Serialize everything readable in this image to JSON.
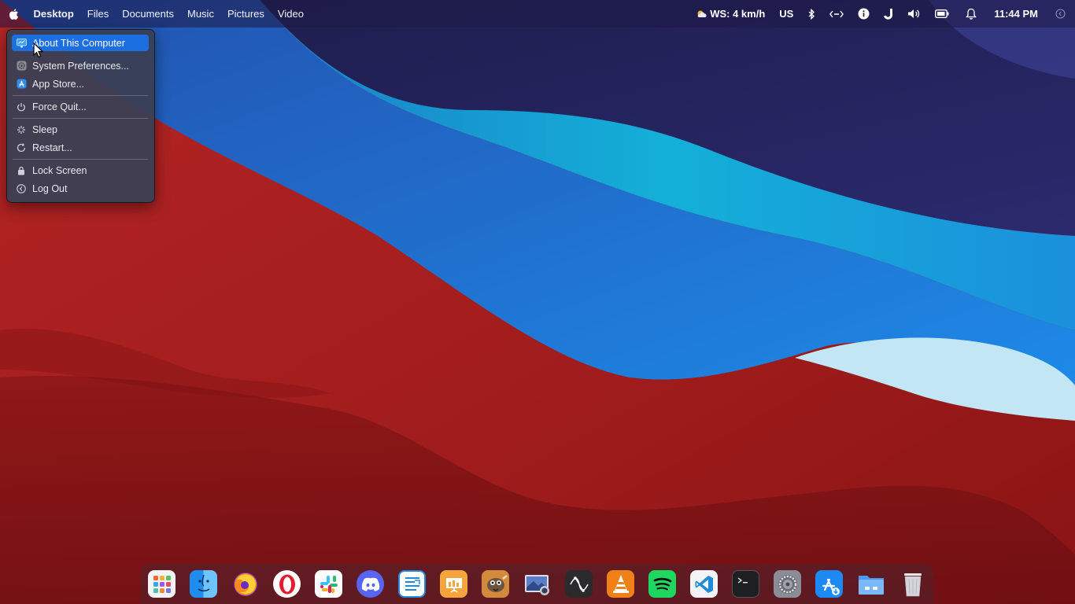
{
  "topbar": {
    "menus": [
      "Desktop",
      "Files",
      "Documents",
      "Music",
      "Pictures",
      "Video"
    ],
    "weather": "WS: 4 km/h",
    "keyboard_layout": "US",
    "clock": "11:44 PM"
  },
  "apple_menu": {
    "items": [
      {
        "label": "About This Computer",
        "icon": "computer-icon"
      },
      {
        "label": "System Preferences...",
        "icon": "gear-icon"
      },
      {
        "label": "App Store...",
        "icon": "app-store-icon"
      },
      {
        "label": "Force Quit...",
        "icon": "power-icon"
      },
      {
        "label": "Sleep",
        "icon": "sleep-icon"
      },
      {
        "label": "Restart...",
        "icon": "restart-icon"
      },
      {
        "label": "Lock Screen",
        "icon": "lock-icon"
      },
      {
        "label": "Log Out",
        "icon": "logout-icon"
      }
    ]
  },
  "dock": {
    "apps": [
      "launchpad",
      "finder",
      "firefox",
      "opera",
      "slack",
      "discord",
      "text-editor",
      "presentation",
      "gimp",
      "screenshot",
      "inkscape",
      "vlc",
      "spotify",
      "vscode",
      "terminal",
      "system-preferences",
      "app-store",
      "files",
      "trash"
    ]
  },
  "colors": {
    "highlight": "#1c6fe0",
    "menu_bg": "#3a4054"
  }
}
